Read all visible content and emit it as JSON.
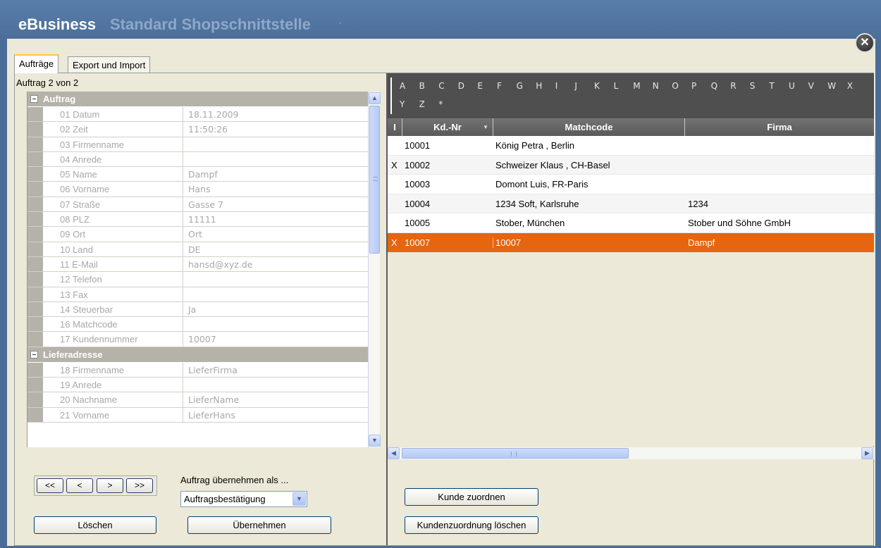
{
  "window": {
    "brand": "eBusiness",
    "title": "Standard Shopschnittstelle",
    "title_menu_glyph": "·",
    "close_glyph": "✕"
  },
  "tabs": [
    {
      "label": "Aufträge",
      "active": true
    },
    {
      "label": "Export und Import",
      "active": false
    }
  ],
  "left": {
    "counter": "Auftrag  2 von 2",
    "categories": [
      {
        "label": "Auftrag",
        "props": [
          {
            "name": "01 Datum",
            "value": "18.11.2009"
          },
          {
            "name": "02 Zeit",
            "value": "11:50:26"
          },
          {
            "name": "03 Firmenname",
            "value": ""
          },
          {
            "name": "04 Anrede",
            "value": ""
          },
          {
            "name": "05 Name",
            "value": "Dampf"
          },
          {
            "name": "06 Vorname",
            "value": "Hans"
          },
          {
            "name": "07 Straße",
            "value": "Gasse 7"
          },
          {
            "name": "08 PLZ",
            "value": "11111"
          },
          {
            "name": "09 Ort",
            "value": "Ort"
          },
          {
            "name": "10 Land",
            "value": "DE"
          },
          {
            "name": "11 E-Mail",
            "value": "hansd@xyz.de"
          },
          {
            "name": "12 Telefon",
            "value": ""
          },
          {
            "name": "13 Fax",
            "value": ""
          },
          {
            "name": "14 Steuerbar",
            "value": "Ja"
          },
          {
            "name": "16 Matchcode",
            "value": ""
          },
          {
            "name": "17 Kundennummer",
            "value": "10007"
          }
        ]
      },
      {
        "label": "Lieferadresse",
        "props": [
          {
            "name": "18 Firmenname",
            "value": "LieferFirma"
          },
          {
            "name": "19 Anrede",
            "value": ""
          },
          {
            "name": "20 Nachname",
            "value": "LieferName"
          },
          {
            "name": "21 Vorname",
            "value": "LieferHans"
          }
        ]
      }
    ],
    "nav": {
      "first": "<<",
      "prev": "<",
      "next": ">",
      "last": ">>"
    },
    "takeover_label": "Auftrag übernehmen als ...",
    "takeover_value": "Auftragsbestätigung",
    "delete_button": "Löschen",
    "apply_button": "Übernehmen"
  },
  "right": {
    "alphabet": [
      "A",
      "B",
      "C",
      "D",
      "E",
      "F",
      "G",
      "H",
      "I",
      "J",
      "K",
      "L",
      "M",
      "N",
      "O",
      "P",
      "Q",
      "R",
      "S",
      "T",
      "U",
      "V",
      "W",
      "X",
      "Y",
      "Z",
      "*"
    ],
    "columns": {
      "flag": "I",
      "number": "Kd.-Nr",
      "matchcode": "Matchcode",
      "company": "Firma"
    },
    "rows": [
      {
        "flag": "",
        "number": "10001",
        "matchcode": "König Petra , Berlin",
        "company": "",
        "selected": false
      },
      {
        "flag": "X",
        "number": "10002",
        "matchcode": "Schweizer Klaus , CH-Basel",
        "company": "",
        "selected": false
      },
      {
        "flag": "",
        "number": "10003",
        "matchcode": "Domont Luis, FR-Paris",
        "company": "",
        "selected": false
      },
      {
        "flag": "",
        "number": "10004",
        "matchcode": "1234 Soft, Karlsruhe",
        "company": "1234",
        "selected": false
      },
      {
        "flag": "",
        "number": "10005",
        "matchcode": "Stober, München",
        "company": "Stober und Söhne GmbH",
        "selected": false
      },
      {
        "flag": "X",
        "number": "10007",
        "matchcode": "10007",
        "company": "Dampf",
        "selected": true
      }
    ],
    "assign_button": "Kunde zuordnen",
    "unassign_button": "Kundenzuordnung löschen"
  },
  "colors": {
    "selection": "#e56510",
    "header": "#5a5a5a",
    "titlebar": "#4a6d98"
  }
}
